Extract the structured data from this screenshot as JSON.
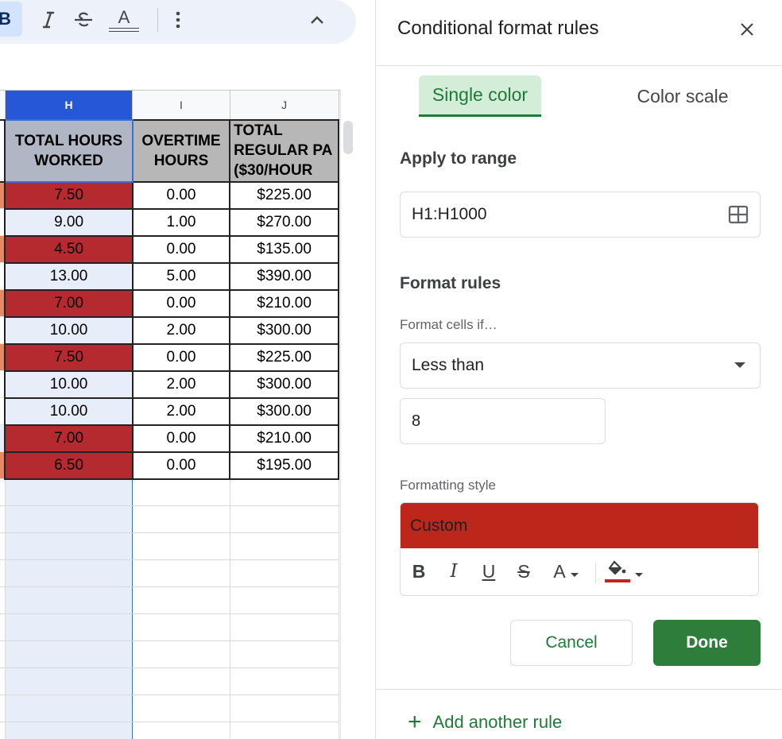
{
  "toolbar": {
    "bold_label": "B",
    "italic_label": "I",
    "strike_label": "S",
    "text_color_label": "A"
  },
  "sheet": {
    "columns": [
      "H",
      "I",
      "J"
    ],
    "header_cells": [
      "TOTAL HOURS WORKED",
      "OVERTIME HOURS",
      "TOTAL REGULAR PA ($30/HOUR"
    ],
    "rows": [
      {
        "h": "7.50",
        "i": "0.00",
        "j": "$225.00",
        "highlight": true
      },
      {
        "h": "9.00",
        "i": "1.00",
        "j": "$270.00",
        "highlight": false
      },
      {
        "h": "4.50",
        "i": "0.00",
        "j": "$135.00",
        "highlight": true
      },
      {
        "h": "13.00",
        "i": "5.00",
        "j": "$390.00",
        "highlight": false
      },
      {
        "h": "7.00",
        "i": "0.00",
        "j": "$210.00",
        "highlight": true
      },
      {
        "h": "10.00",
        "i": "2.00",
        "j": "$300.00",
        "highlight": false
      },
      {
        "h": "7.50",
        "i": "0.00",
        "j": "$225.00",
        "highlight": true
      },
      {
        "h": "10.00",
        "i": "2.00",
        "j": "$300.00",
        "highlight": false
      },
      {
        "h": "10.00",
        "i": "2.00",
        "j": "$300.00",
        "highlight": false
      },
      {
        "h": "7.00",
        "i": "0.00",
        "j": "$210.00",
        "highlight": true
      },
      {
        "h": "6.50",
        "i": "0.00",
        "j": "$195.00",
        "highlight": true
      }
    ],
    "highlight_color": "#b52a2e",
    "selected_column_color": "#e8eef9"
  },
  "panel": {
    "title": "Conditional format rules",
    "tabs": [
      {
        "label": "Single color",
        "active": true
      },
      {
        "label": "Color scale",
        "active": false
      }
    ],
    "apply_to_range_label": "Apply to range",
    "range_value": "H1:H1000",
    "format_rules_label": "Format rules",
    "format_cells_if_label": "Format cells if…",
    "condition": "Less than",
    "condition_value": "8",
    "formatting_style_label": "Formatting style",
    "style_preview_label": "Custom",
    "style_fill_color": "#bd271b",
    "style_tools": {
      "bold": "B",
      "italic": "I",
      "underline": "U",
      "strike": "S",
      "text_color": "A"
    },
    "cancel_label": "Cancel",
    "done_label": "Done",
    "add_rule_label": "Add another rule",
    "accent_color": "#1e7a37"
  }
}
